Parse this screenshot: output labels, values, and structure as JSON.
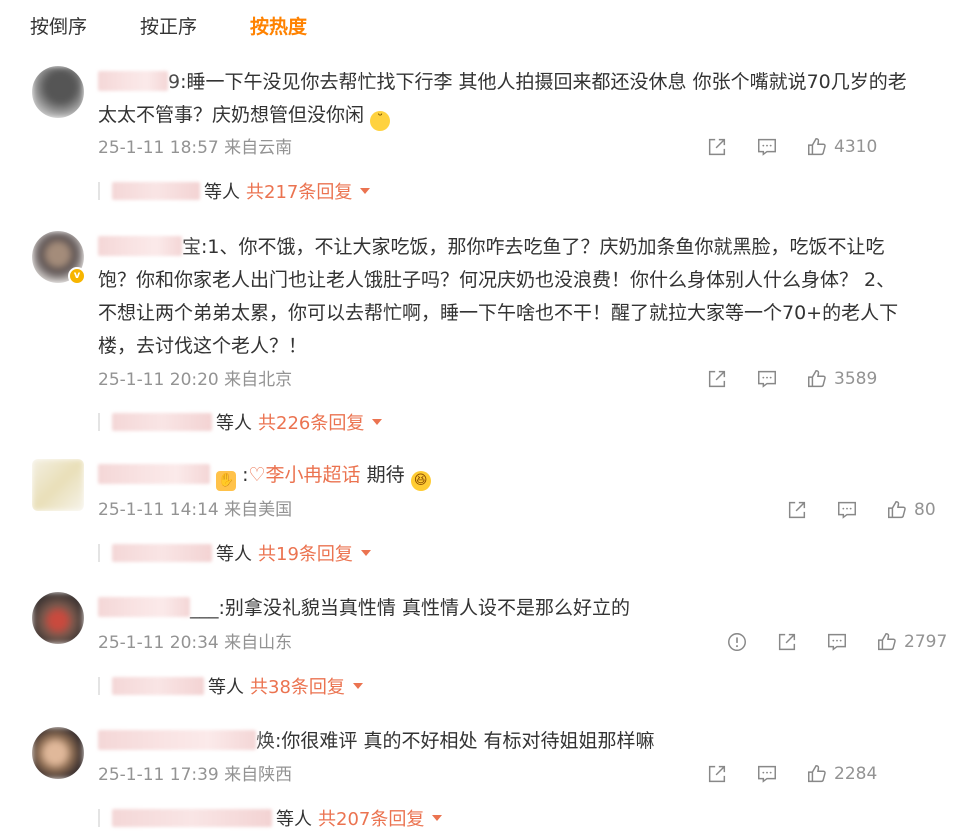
{
  "tabs": [
    {
      "label": "按倒序",
      "active": false
    },
    {
      "label": "按正序",
      "active": false
    },
    {
      "label": "按热度",
      "active": true
    }
  ],
  "accent_color": "#ff8200",
  "link_color": "#eb7350",
  "comments": [
    {
      "name_suffix": "9",
      "text_line1": ":睡一下午没见你去帮忙找下行李 其他人拍摄回来都还没休息 你张个嘴就说70几岁的老",
      "text_line2": "太太不管事？庆奶想管但没你闲",
      "emoji": "unamused-face-icon",
      "time": "25-1-11 18:57",
      "location": "来自云南",
      "likes": "4310",
      "reply_by": "等人",
      "reply_total": "共217条回复"
    },
    {
      "name_suffix": "宝",
      "text_lines": [
        ":1、你不饿，不让大家吃饭，那你咋去吃鱼了？庆奶加条鱼你就黑脸，吃饭不让吃",
        "饱？你和你家老人出门也让老人饿肚子吗？何况庆奶也没浪费！你什么身体别人什么身体？ 2、",
        "不想让两个弟弟太累，你可以去帮忙啊，睡一下午啥也不干！醒了就拉大家等一个70+的老人下",
        "楼，去讨伐这个老人？！"
      ],
      "time": "25-1-11 20:20",
      "location": "来自北京",
      "likes": "3589",
      "reply_by": "等人",
      "reply_total": "共226条回复"
    },
    {
      "topic": "李小冉超话",
      "text_after": " 期待",
      "time": "25-1-11 14:14",
      "location": "来自美国",
      "likes": "80",
      "reply_by": "等人",
      "reply_total": "共19条回复"
    },
    {
      "name_suffix": "___",
      "text": ":别拿没礼貌当真性情  真性情人设不是那么好立的",
      "time": "25-1-11 20:34",
      "location": "来自山东",
      "likes": "2797",
      "reply_by": "等人",
      "reply_total": "共38条回复"
    },
    {
      "name_suffix": "焕",
      "text": ":你很难评 真的不好相处 有标对待姐姐那样嘛",
      "time": "25-1-11 17:39",
      "location": "来自陕西",
      "likes": "2284",
      "reply_by": "等人",
      "reply_total": "共207条回复"
    }
  ]
}
